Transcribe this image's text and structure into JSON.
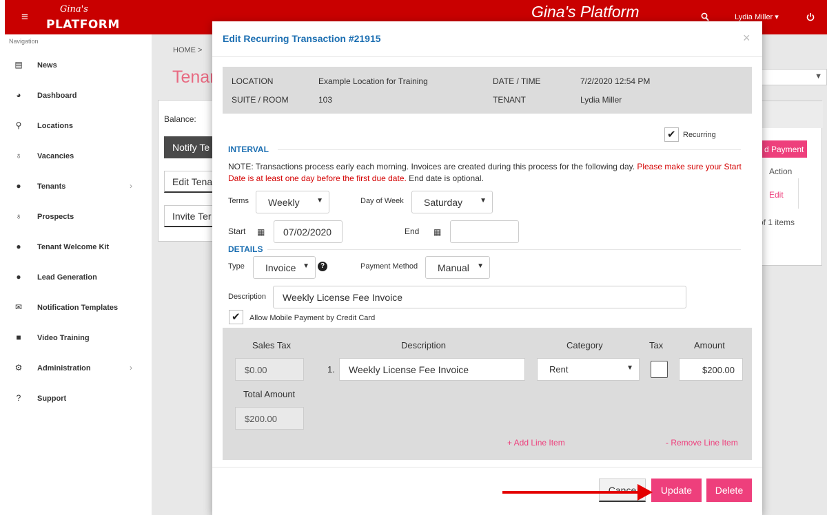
{
  "topbar": {
    "menu_icon": "≡",
    "logo_script": "Gina's",
    "logo_main": "PLATFORM",
    "brand_title": "Gina's Platform",
    "user_name": "Lydia Miller ▾",
    "search_icon": "search-icon",
    "power_icon": "power-icon"
  },
  "sidebar": {
    "caption": "Navigation",
    "items": [
      {
        "label": "News",
        "icon": "newspaper-icon",
        "glyph": "▤"
      },
      {
        "label": "Dashboard",
        "icon": "dashboard-icon",
        "glyph": "◕"
      },
      {
        "label": "Locations",
        "icon": "pin-icon",
        "glyph": "⚲"
      },
      {
        "label": "Vacancies",
        "icon": "lock-icon",
        "glyph": "♁"
      },
      {
        "label": "Tenants",
        "icon": "user-icon",
        "glyph": "●"
      },
      {
        "label": "Prospects",
        "icon": "lock-icon",
        "glyph": "♁"
      },
      {
        "label": "Tenant Welcome Kit",
        "icon": "user-icon",
        "glyph": "●"
      },
      {
        "label": "Lead Generation",
        "icon": "user-icon",
        "glyph": "●"
      },
      {
        "label": "Notification Templates",
        "icon": "envelope-icon",
        "glyph": "✉"
      },
      {
        "label": "Video Training",
        "icon": "video-icon",
        "glyph": "■"
      },
      {
        "label": "Administration",
        "icon": "gear-icon",
        "glyph": "⚙"
      },
      {
        "label": "Support",
        "icon": "question-icon",
        "glyph": "?"
      }
    ],
    "chevron": "›"
  },
  "page": {
    "breadcrumb": "HOME  >",
    "title": "Tenar",
    "balance_label": "Balance:",
    "notify_button": "Notify Te",
    "edit_button": "Edit Tena",
    "invite_button": "Invite Ter",
    "payment_button": "d Payment",
    "action_header": "Action",
    "edit_link": "Edit",
    "items_text": "of 1 items"
  },
  "modal": {
    "title": "Edit Recurring Transaction #21915",
    "close": "×",
    "info": {
      "location_label": "LOCATION",
      "location_value": "Example Location for Training",
      "datetime_label": "DATE / TIME",
      "datetime_value": "7/2/2020 12:54 PM",
      "suite_label": "SUITE / ROOM",
      "suite_value": "103",
      "tenant_label": "TENANT",
      "tenant_value": "Lydia Miller"
    },
    "recurring_label": "Recurring",
    "interval": {
      "heading": "INTERVAL",
      "note_plain": "NOTE: Transactions process early each morning. Invoices are created during this process for the following day. ",
      "note_red": "Please make sure your Start Date is at least one day before the first due date.",
      "note_end": " End date is optional.",
      "terms_label": "Terms",
      "terms_value": "Weekly",
      "dow_label": "Day of Week",
      "dow_value": "Saturday",
      "start_label": "Start",
      "start_value": "07/02/2020",
      "end_label": "End",
      "end_value": ""
    },
    "details": {
      "heading": "DETAILS",
      "type_label": "Type",
      "type_value": "Invoice",
      "payment_method_label": "Payment Method",
      "payment_method_value": "Manual",
      "description_label": "Description",
      "description_value": "Weekly License Fee Invoice",
      "mobile_payment_label": "Allow Mobile Payment by Credit Card"
    },
    "lines": {
      "headers": {
        "sales_tax": "Sales Tax",
        "description": "Description",
        "category": "Category",
        "tax": "Tax",
        "amount": "Amount"
      },
      "sales_tax_value": "$0.00",
      "items": [
        {
          "num": "1.",
          "description": "Weekly License Fee Invoice",
          "category": "Rent",
          "taxed": false,
          "amount": "$200.00"
        }
      ],
      "total_label": "Total Amount",
      "total_value": "$200.00",
      "add_link": "+ Add Line Item",
      "remove_link": "- Remove Line Item"
    },
    "footer": {
      "cancel": "Cance",
      "update": "Update",
      "delete": "Delete"
    }
  },
  "colors": {
    "brand_red": "#c90000",
    "accent_pink": "#ee3f7c",
    "heading_blue": "#1c6fb2",
    "annotation_arrow": "#e40000"
  }
}
